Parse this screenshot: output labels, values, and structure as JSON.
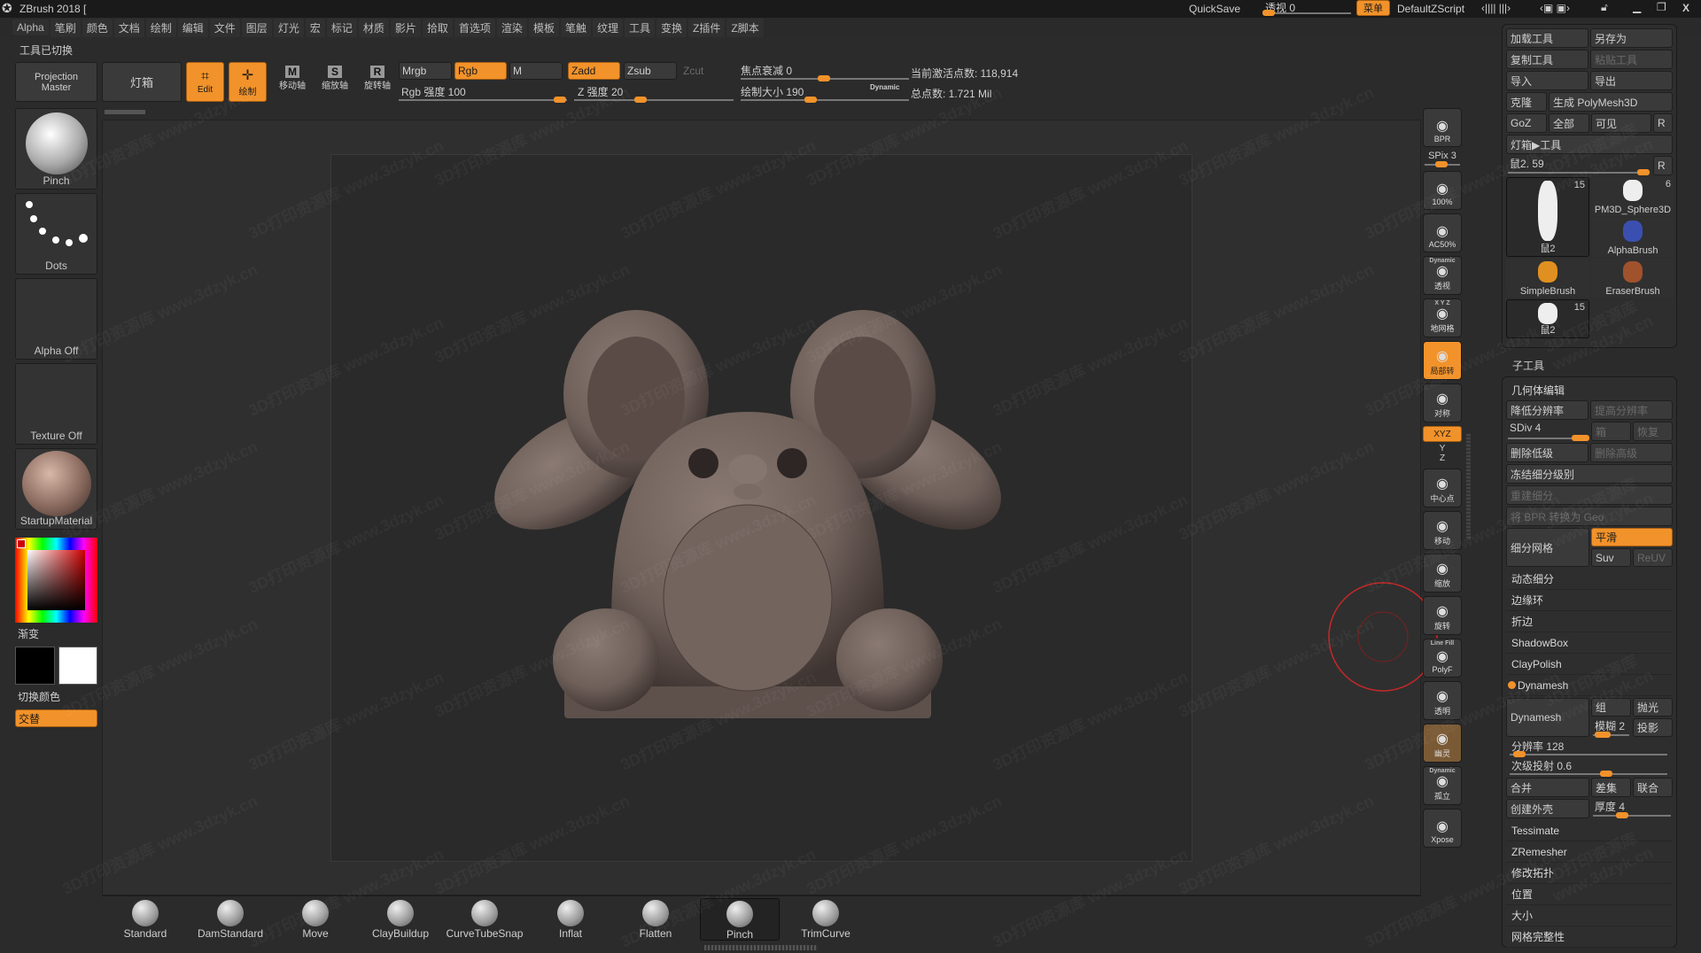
{
  "colors": {
    "accent": "#f2922a",
    "model": "#6f605a",
    "bg": "#2b2b2b"
  },
  "titlebar": {
    "app_title": "ZBrush 2018 [",
    "quicksave": "QuickSave",
    "perspective_label": "透视 0",
    "perspective_value": 0,
    "menu_button": "菜单",
    "script": "DefaultZScript",
    "icons": [
      "zbrush-logo-icon",
      "layout-arrows-icon",
      "palette-arrows-icon",
      "lock-icon",
      "minimize-icon",
      "restore-icon",
      "close-icon"
    ],
    "close": "X"
  },
  "menubar": [
    "Alpha",
    "笔刷",
    "颜色",
    "文档",
    "绘制",
    "编辑",
    "文件",
    "图层",
    "灯光",
    "宏",
    "标记",
    "材质",
    "影片",
    "拾取",
    "首选项",
    "渲染",
    "模板",
    "笔触",
    "纹理",
    "工具",
    "变换",
    "Z插件",
    "Z脚本"
  ],
  "status_note": "工具已切换",
  "toolbar": {
    "projection_master": "Projection Master",
    "lightbox": "灯箱",
    "edit": "Edit",
    "draw": "绘制",
    "move": "移动轴",
    "scale": "缩放轴",
    "rotate": "旋转轴",
    "move_key": "M",
    "scale_key": "S",
    "rotate_key": "R",
    "mrgb": "Mrgb",
    "rgb": "Rgb",
    "m": "M",
    "zadd": "Zadd",
    "zsub": "Zsub",
    "zcut": "Zcut",
    "rgb_intensity": "Rgb 强度 100",
    "rgb_intensity_value": 100,
    "z_intensity": "Z 强度 20",
    "z_intensity_value": 20,
    "focal_shift": "焦点衰减 0",
    "focal_shift_value": 0,
    "draw_size": "绘制大小 190",
    "draw_size_value": 190,
    "dynamic": "Dynamic",
    "active_points": "当前激活点数: 118,914",
    "total_points": "总点数: 1.721 Mil"
  },
  "left_panel": {
    "brush": "Pinch",
    "stroke": "Dots",
    "alpha": "Alpha Off",
    "texture": "Texture Off",
    "material": "StartupMaterial",
    "gradient": "渐变",
    "switch_color": "切换颜色",
    "alternate": "交替",
    "main_color": "#000000",
    "secondary_color": "#ffffff"
  },
  "shelf": [
    {
      "label": "BPR",
      "icon": "bpr-sphere-icon"
    },
    {
      "label": "100%",
      "icon": "zoom-actual-icon"
    },
    {
      "label": "AC50%",
      "icon": "zoom-half-icon"
    },
    {
      "label": "透视",
      "icon": "perspective-icon",
      "top": "Dynamic"
    },
    {
      "label": "地网格",
      "icon": "floor-grid-icon",
      "top": "X Y Z"
    },
    {
      "label": "局部转",
      "icon": "local-rotate-icon",
      "active": true
    },
    {
      "label": "对称",
      "icon": "symmetry-icon"
    },
    {
      "label": "中心点",
      "icon": "center-point-icon"
    },
    {
      "label": "移动",
      "icon": "move-hand-icon"
    },
    {
      "label": "缩放",
      "icon": "zoom-icon"
    },
    {
      "label": "旋转",
      "icon": "rotate-icon"
    },
    {
      "label": "PolyF",
      "icon": "polyframe-icon",
      "top": "Line Fill"
    },
    {
      "label": "透明",
      "icon": "transparent-icon"
    },
    {
      "label": "幽灵",
      "icon": "ghost-icon",
      "active_dim": true
    },
    {
      "label": "孤立",
      "icon": "solo-icon",
      "top": "Dynamic"
    },
    {
      "label": "Xpose",
      "icon": "xpose-icon"
    }
  ],
  "shelf_extra": {
    "spix": "SPix 3",
    "spix_value": 3,
    "xyz": "XYZ",
    "y": "Y",
    "z": "Z"
  },
  "tool_panel": {
    "load": "加载工具",
    "save_as": "另存为",
    "copy": "复制工具",
    "paste": "粘贴工具",
    "import": "导入",
    "export": "导出",
    "clone": "克隆",
    "make_polymesh": "生成 PolyMesh3D",
    "goz": "GoZ",
    "all": "全部",
    "visible": "可见",
    "r": "R",
    "lightbox_tools": "灯箱▶工具",
    "current_tool": "鼠2. 59",
    "current_tool_value": 59,
    "tools": [
      {
        "name": "鼠2",
        "count": "15"
      },
      {
        "name": "PM3D_Sphere3D",
        "count": "6"
      },
      {
        "name": "AlphaBrush",
        "count": ""
      },
      {
        "name": "SimpleBrush",
        "count": ""
      },
      {
        "name": "EraserBrush",
        "count": ""
      },
      {
        "name": "鼠2",
        "count": "15"
      }
    ]
  },
  "subtool_header": "子工具",
  "geometry": {
    "header": "几何体编辑",
    "lower_res": "降低分辨率",
    "higher_res": "提高分辨率",
    "sdiv": "SDiv 4",
    "sdiv_value": 4,
    "cage": "箱",
    "restore": "恢复",
    "del_lower": "删除低级",
    "del_higher": "删除高级",
    "freeze": "冻结细分级别",
    "reconstruct": "重建细分",
    "bpr_geo": "将 BPR 转换为 Geo",
    "divide": "细分网格",
    "smooth": "平滑",
    "suv": "Suv",
    "reuv": "ReUV",
    "sections": [
      "动态细分",
      "边缘环",
      "折边",
      "ShadowBox",
      "ClayPolish"
    ],
    "dynamesh_header": "Dynamesh",
    "dynamesh_btn": "Dynamesh",
    "group": "组",
    "polish": "抛光",
    "blur": "模糊 2",
    "blur_value": 2,
    "project": "投影",
    "resolution": "分辨率 128",
    "resolution_value": 128,
    "sub_projection": "次级投射 0.6",
    "sub_projection_value": 0.6,
    "add": "合并",
    "sub": "差集",
    "and": "联合",
    "create_shell": "创建外壳",
    "thickness": "厚度 4",
    "thickness_value": 4,
    "sections2": [
      "Tessimate",
      "ZRemesher",
      "修改拓扑",
      "位置",
      "大小",
      "网格完整性"
    ]
  },
  "brushes": [
    {
      "name": "Standard"
    },
    {
      "name": "DamStandard"
    },
    {
      "name": "Move"
    },
    {
      "name": "ClayBuildup"
    },
    {
      "name": "CurveTubeSnap"
    },
    {
      "name": "Inflat"
    },
    {
      "name": "Flatten"
    },
    {
      "name": "Pinch",
      "selected": true
    },
    {
      "name": "TrimCurve"
    }
  ],
  "watermark": "3D打印资源库 www.3dzyk.cn"
}
